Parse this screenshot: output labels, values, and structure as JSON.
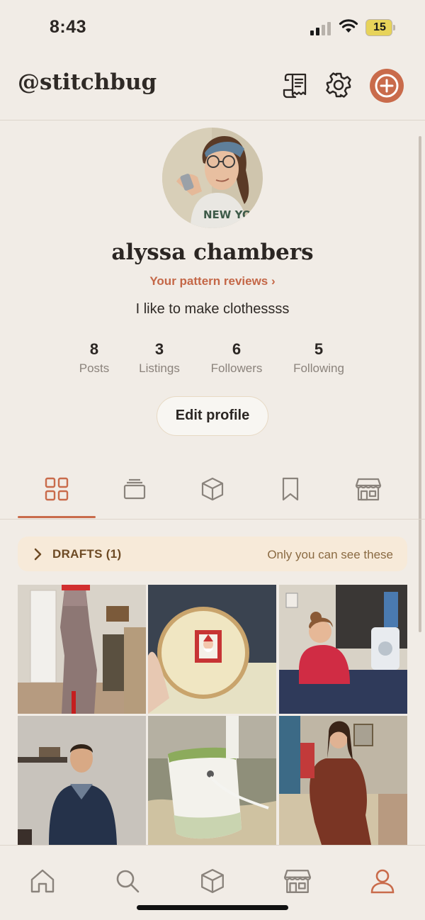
{
  "status_bar": {
    "time": "8:43",
    "battery": "15"
  },
  "header": {
    "handle": "@stitchbug"
  },
  "profile": {
    "name": "alyssa chambers",
    "reviews_link": "Your pattern reviews ›",
    "bio": "I like to make clothessss"
  },
  "stats": [
    {
      "value": "8",
      "label": "Posts"
    },
    {
      "value": "3",
      "label": "Listings"
    },
    {
      "value": "6",
      "label": "Followers"
    },
    {
      "value": "5",
      "label": "Following"
    }
  ],
  "edit_button": "Edit profile",
  "tabs": [
    {
      "icon": "grid-icon",
      "active": true
    },
    {
      "icon": "cards-stack-icon",
      "active": false
    },
    {
      "icon": "box-icon",
      "active": false
    },
    {
      "icon": "bookmark-icon",
      "active": false
    },
    {
      "icon": "storefront-icon",
      "active": false
    }
  ],
  "drafts": {
    "label": "DRAFTS (1)",
    "note": "Only you can see these"
  },
  "bottom_nav": [
    {
      "icon": "home-icon",
      "active": false
    },
    {
      "icon": "search-icon",
      "active": false
    },
    {
      "icon": "box-icon",
      "active": false
    },
    {
      "icon": "storefront-icon",
      "active": false
    },
    {
      "icon": "profile-icon",
      "active": true
    }
  ],
  "colors": {
    "accent": "#c96b4b",
    "background": "#f1ece6",
    "drafts_bg": "#f7ead9",
    "text": "#2b2623",
    "muted": "#8b837c"
  }
}
